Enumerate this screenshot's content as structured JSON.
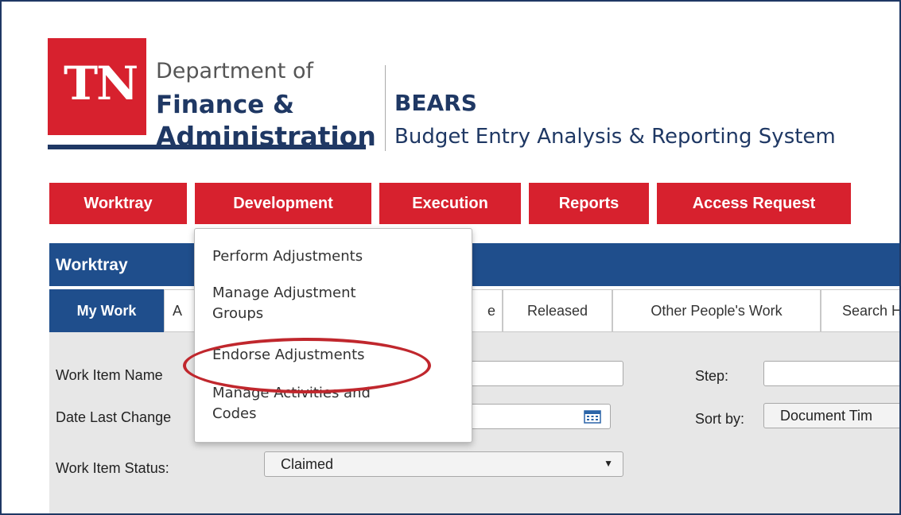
{
  "logo": {
    "mark": "TN",
    "dept_line1": "Department of",
    "dept_line2": "Finance &",
    "dept_line3": "Administration"
  },
  "system": {
    "name": "BEARS",
    "description": "Budget Entry Analysis & Reporting System"
  },
  "nav": {
    "items": [
      "Worktray",
      "Development",
      "Execution",
      "Reports",
      "Access Request"
    ]
  },
  "panel": {
    "title": "Worktray"
  },
  "tabs": [
    {
      "label": "My Work",
      "active": true
    },
    {
      "label": "A"
    },
    {
      "label": "e"
    },
    {
      "label": "Released"
    },
    {
      "label": "Other People's Work"
    },
    {
      "label": "Search H"
    }
  ],
  "filters": {
    "work_item_name_label": "Work Item Name",
    "date_last_changed_label": "Date Last Change",
    "work_item_status_label": "Work Item Status:",
    "work_item_status_value": "Claimed",
    "step_label": "Step:",
    "sort_by_label": "Sort by:",
    "sort_by_value": "Document Tim"
  },
  "dropdown": {
    "items": [
      "Perform Adjustments",
      "Manage Adjustment\nGroups",
      "Endorse Adjustments",
      "Manage Activities and\nCodes"
    ],
    "highlighted_index": 2
  },
  "colors": {
    "brand_red": "#d7212e",
    "navy": "#1f3864",
    "panel_blue": "#1f4e8c",
    "highlight_ring": "#c0272d"
  },
  "icons": {
    "calendar": "calendar-icon",
    "dropdown_caret": "caret-down-icon"
  }
}
